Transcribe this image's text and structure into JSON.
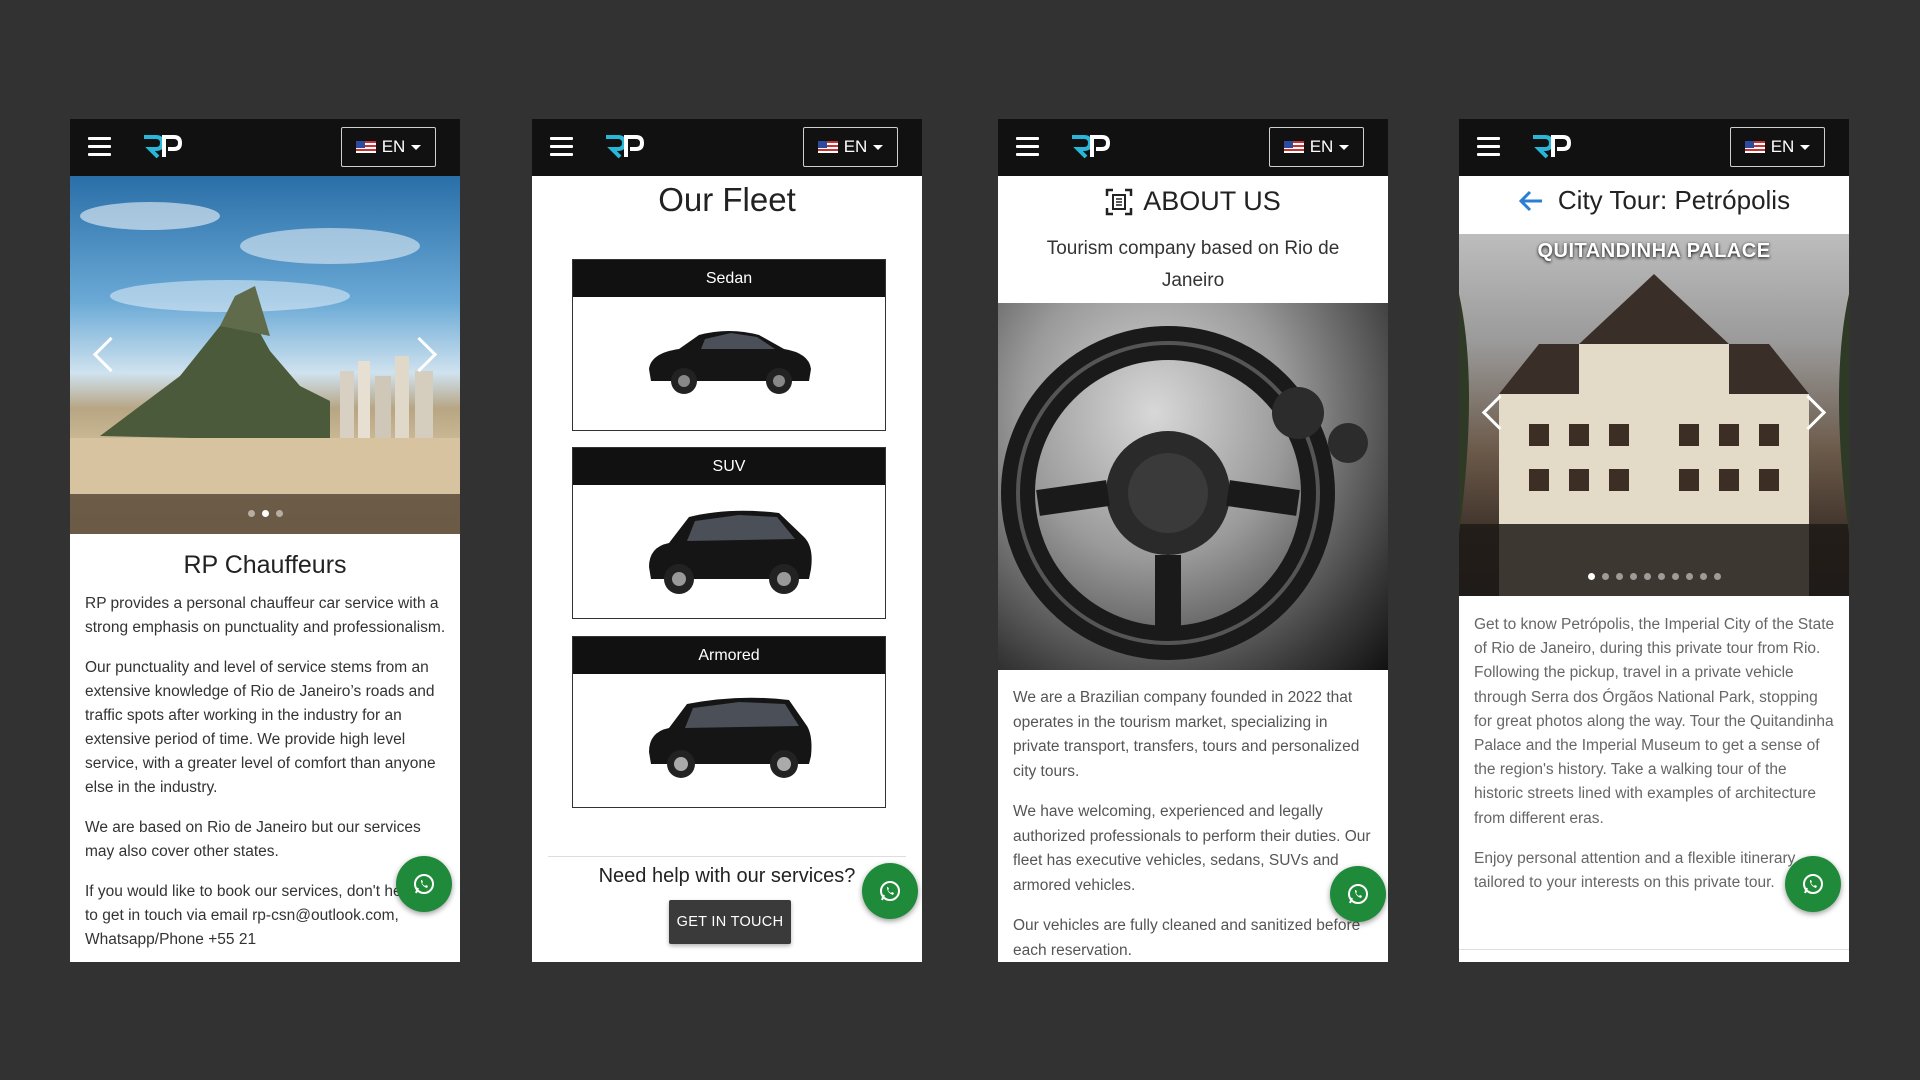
{
  "colors": {
    "background": "#323232",
    "appbar": "#111111",
    "whatsapp": "#1f8b3a",
    "accent": "#2a7fd4"
  },
  "appbar": {
    "lang_label": "EN",
    "menu_icon": "hamburger-icon",
    "logo_icon": "rp-logo",
    "flag_icon": "us-flag-icon",
    "whatsapp_icon": "whatsapp-icon"
  },
  "home": {
    "title": "RP Chauffeurs",
    "carousel_active_index": 1,
    "carousel_count": 3,
    "paragraphs": [
      "RP provides a personal chauffeur car service with a strong emphasis on punctuality and professionalism.",
      "Our punctuality and level of service stems from an extensive knowledge of Rio de Janeiro’s roads and traffic spots after working in the industry for an extensive period of time. We provide high level service, with a greater level of comfort than anyone else in the industry.",
      "We are based on Rio de Janeiro but our services may also cover other states.",
      "If you would like to book our services, don't hesitate to get in touch via email rp-csn@outlook.com, Whatsapp/Phone +55 21"
    ]
  },
  "fleet": {
    "title": "Our Fleet",
    "cards": [
      "Sedan",
      "SUV",
      "Armored"
    ],
    "help_text": "Need help with our services?",
    "cta_label": "GET IN TOUCH"
  },
  "about": {
    "title": "ABOUT US",
    "subtitle": "Tourism company based on Rio de Janeiro",
    "paragraphs": [
      "We are a Brazilian company founded in 2022 that operates in the tourism market, specializing in private transport, transfers, tours and personalized city tours.",
      "We have welcoming, experienced and legally authorized professionals to perform their duties. Our fleet has executive vehicles, sedans, SUVs and armored vehicles.",
      "Our vehicles are fully cleaned and sanitized before each reservation."
    ]
  },
  "tour": {
    "title": "City Tour: Petrópolis",
    "carousel_label": "QUITANDINHA PALACE",
    "carousel_active_index": 0,
    "carousel_count": 10,
    "paragraphs": [
      "Get to know Petrópolis, the Imperial City of the State of Rio de Janeiro, during this private tour from Rio. Following the pickup, travel in a private vehicle through Serra dos Órgãos National Park, stopping for great photos along the way. Tour the Quitandinha Palace and the Imperial Museum to get a sense of the region's history. Take a walking tour of the historic streets lined with examples of architecture from different eras.",
      "Enjoy personal attention and a flexible itinerary tailored to your interests on this private tour."
    ]
  }
}
